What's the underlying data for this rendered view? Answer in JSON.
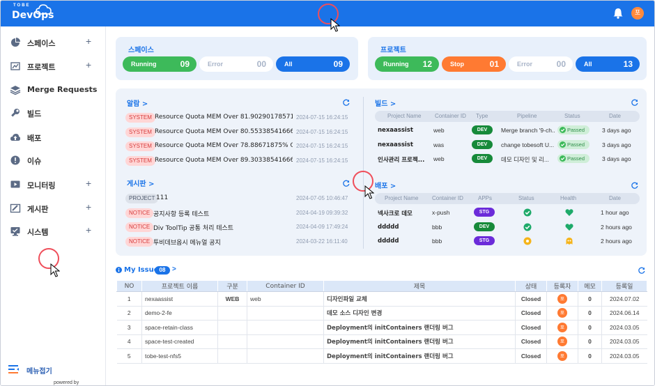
{
  "header": {
    "logo_small": "TOBE",
    "logo_big": "DevOps",
    "user_initial": "포"
  },
  "sidebar": {
    "items": [
      {
        "label": "스페이스",
        "icon": "pie-chart-icon",
        "plus": true
      },
      {
        "label": "프로젝트",
        "icon": "line-chart-icon",
        "plus": true
      },
      {
        "label": "Merge Requests",
        "icon": "layers-icon",
        "plus": false
      },
      {
        "label": "빌드",
        "icon": "wrench-icon",
        "plus": false
      },
      {
        "label": "배포",
        "icon": "cloud-upload-icon",
        "plus": false
      },
      {
        "label": "이슈",
        "icon": "alert-circle-icon",
        "plus": false
      },
      {
        "label": "모니터링",
        "icon": "monitor-play-icon",
        "plus": true
      },
      {
        "label": "게시판",
        "icon": "board-icon",
        "plus": true
      },
      {
        "label": "시스템",
        "icon": "system-monitor-icon",
        "plus": true
      }
    ],
    "plus_glyph": "+",
    "menu_fold_label": "메뉴접기",
    "powered_by": "powered by TOBESOFT"
  },
  "spaces": {
    "title": "스페이스",
    "running_label": "Running",
    "running_value": "09",
    "error_label": "Error",
    "error_value": "00",
    "all_label": "All",
    "all_value": "09"
  },
  "projects": {
    "title": "프로젝트",
    "running_label": "Running",
    "running_value": "12",
    "stop_label": "Stop",
    "stop_value": "01",
    "error_label": "Error",
    "error_value": "00",
    "all_label": "All",
    "all_value": "13"
  },
  "alarm": {
    "title": "알람 >",
    "rows": [
      {
        "tag": "SYSTEM",
        "text": "Resource Quota MEM Over 81.9029017857142...",
        "date": "2024-07-15 16:24:15"
      },
      {
        "tag": "SYSTEM",
        "text": "Resource Quota MEM Over 80.5533854166666...",
        "date": "2024-07-15 16:24:15"
      },
      {
        "tag": "SYSTEM",
        "text": "Resource Quota MEM Over 78.88671875% On ...",
        "date": "2024-07-15 16:24:15"
      },
      {
        "tag": "SYSTEM",
        "text": "Resource Quota MEM Over 89.3033854166666...",
        "date": "2024-07-15 16:24:15"
      }
    ]
  },
  "board": {
    "title": "게시판 >",
    "rows": [
      {
        "tag": "PROJECT",
        "text": "111",
        "date": "2024-07-05 10:46:47"
      },
      {
        "tag": "NOTICE",
        "text": "공지사항 등록 테스트",
        "date": "2024-04-19 09:39:32"
      },
      {
        "tag": "NOTICE",
        "text": "Div ToolTip 공통 처리 테스트",
        "date": "2024-04-09 17:49:24"
      },
      {
        "tag": "NOTICE",
        "text": "투비데브옵시 메뉴얼 공지",
        "date": "2024-03-22 16:11:40"
      }
    ]
  },
  "build": {
    "title": "빌드 >",
    "headers": [
      "Project Name",
      "Container ID",
      "Type",
      "Pipeline",
      "Status",
      "Date"
    ],
    "rows": [
      {
        "project": "nexaassist",
        "container": "web",
        "type": "DEV",
        "pipeline": "Merge branch '9-ch...",
        "status": "Passed",
        "date": "3 days ago"
      },
      {
        "project": "nexaassist",
        "container": "was",
        "type": "DEV",
        "pipeline": "change tobesoft U...",
        "status": "Passed",
        "date": "3 days ago"
      },
      {
        "project": "인사관리 프로젝...",
        "container": "web",
        "type": "DEV",
        "pipeline": "데모 디자인 및 리...",
        "status": "Passed",
        "date": "3 days ago"
      }
    ]
  },
  "deploy": {
    "title": "배포 >",
    "headers": [
      "Project Name",
      "Container ID",
      "APPs",
      "Status",
      "Health",
      "Date"
    ],
    "rows": [
      {
        "project": "넥사크로 데모",
        "container": "x-push",
        "app": "STG",
        "status": "ok",
        "health": "healthy",
        "date": "1 hour ago"
      },
      {
        "project": "ddddd",
        "container": "bbb",
        "app": "DEV",
        "status": "ok",
        "health": "healthy",
        "date": "2 hours ago"
      },
      {
        "project": "ddddd",
        "container": "bbb",
        "app": "STG",
        "status": "pending",
        "health": "unknown",
        "date": "2 hours ago"
      }
    ]
  },
  "issues": {
    "title": "My Issue",
    "count": "08",
    "chevron": ">",
    "headers": [
      "NO",
      "프로젝트 이름",
      "구분",
      "Container ID",
      "제목",
      "상태",
      "등록자",
      "메모",
      "등록일"
    ],
    "rows": [
      {
        "no": "1",
        "project": "nexaassist",
        "kind": "WEB",
        "container": "web",
        "title": "디자인파일 교체",
        "status": "Closed",
        "user": "포",
        "memo": "0",
        "date": "2024.07.02"
      },
      {
        "no": "2",
        "project": "demo-2-fe",
        "kind": "",
        "container": "",
        "title": "데모 소스 디자인 변경",
        "status": "Closed",
        "user": "포",
        "memo": "0",
        "date": "2024.06.14"
      },
      {
        "no": "3",
        "project": "space-retain-class",
        "kind": "",
        "container": "",
        "title": "Deployment의 initContainers 랜더링 버그",
        "status": "Closed",
        "user": "포",
        "memo": "0",
        "date": "2024.03.05"
      },
      {
        "no": "4",
        "project": "space-test-created",
        "kind": "",
        "container": "",
        "title": "Deployment의 initContainers 랜더링 버그",
        "status": "Closed",
        "user": "포",
        "memo": "0",
        "date": "2024.03.05"
      },
      {
        "no": "5",
        "project": "tobe-test-nfs5",
        "kind": "",
        "container": "",
        "title": "Deployment의 initContainers 랜더링 버그",
        "status": "Closed",
        "user": "포",
        "memo": "0",
        "date": "2024.03.05"
      }
    ]
  },
  "colors": {
    "accent": "#1a73e8",
    "running": "#3dba5a",
    "stop": "#ff7a32",
    "dev": "#178a3a",
    "stg": "#6b2bd9"
  }
}
